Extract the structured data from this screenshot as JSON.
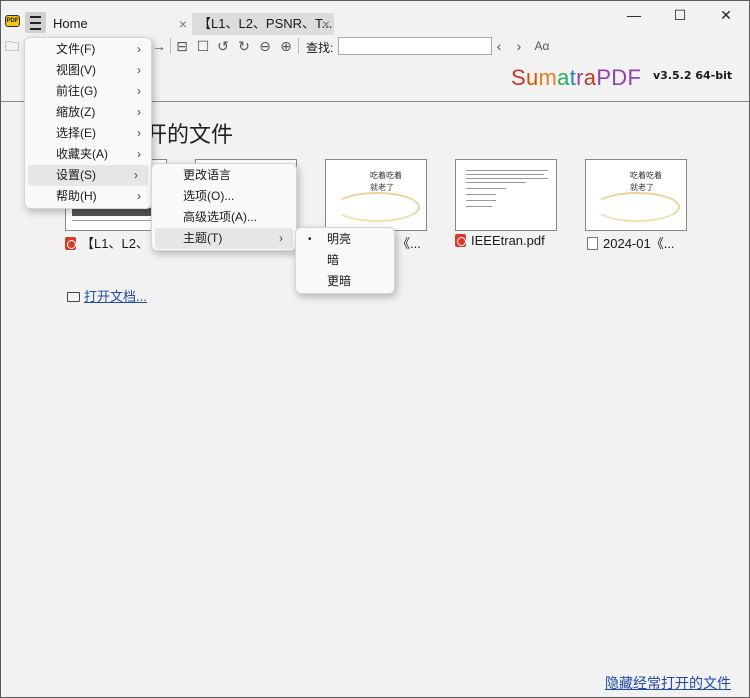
{
  "tabs": [
    {
      "label": "Home",
      "close": "×"
    },
    {
      "label": "【L1、L2、PSNR、T...",
      "close": "×"
    }
  ],
  "window_controls": {
    "minimize": "—",
    "maximize": "☐",
    "close": "✕"
  },
  "app_icon_text": "PDF",
  "toolbar": {
    "find_label": "查找:",
    "find_value": "",
    "text_size_glyph": "Aα"
  },
  "brand": {
    "name_parts": [
      "S",
      "u",
      "m",
      "a",
      "t",
      "r",
      "a",
      "PDF"
    ],
    "version": "v3.5.2 64-bit"
  },
  "section_title": "开的文件",
  "recent_files": [
    {
      "label": "【L1、L2、",
      "icon": "pdf-icon"
    },
    {
      "label": "《...",
      "icon": "doc-icon"
    },
    {
      "label": "IEEEtran.pdf",
      "icon": "pdf-icon"
    },
    {
      "label": "2024-01《...",
      "icon": "doc-icon"
    }
  ],
  "thumb_text": {
    "line1": "吃着吃着",
    "line2": "就老了"
  },
  "open_document": "打开文档...",
  "hide_frequently_opened": "隐藏经常打开的文件",
  "main_menu": [
    {
      "label": "文件(F)",
      "arrow": "›"
    },
    {
      "label": "视图(V)",
      "arrow": "›"
    },
    {
      "label": "前往(G)",
      "arrow": "›"
    },
    {
      "label": "缩放(Z)",
      "arrow": "›"
    },
    {
      "label": "选择(E)",
      "arrow": "›"
    },
    {
      "label": "收藏夹(A)",
      "arrow": "›"
    },
    {
      "label": "设置(S)",
      "arrow": "›"
    },
    {
      "label": "帮助(H)",
      "arrow": "›"
    }
  ],
  "settings_menu": [
    {
      "label": "更改语言"
    },
    {
      "label": "选项(O)..."
    },
    {
      "label": "高级选项(A)..."
    },
    {
      "label": "主题(T)",
      "arrow": "›"
    }
  ],
  "theme_menu": {
    "bullet": "•",
    "items": [
      {
        "label": "明亮"
      },
      {
        "label": "暗"
      },
      {
        "label": "更暗"
      }
    ]
  }
}
